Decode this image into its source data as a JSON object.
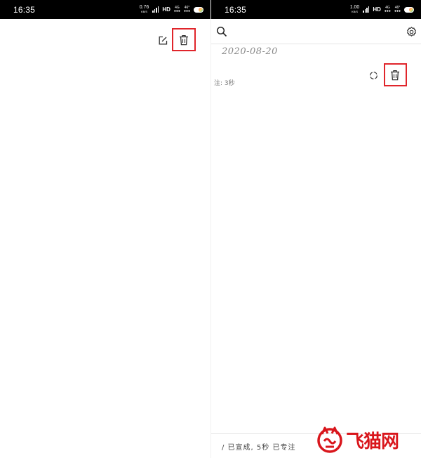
{
  "left": {
    "status": {
      "time": "16:35",
      "net_speed": "0.76",
      "net_unit": "KB/S",
      "hd": "HD",
      "net_type": "4G",
      "signal": "46°"
    }
  },
  "right": {
    "status": {
      "time": "16:35",
      "net_speed": "1.00",
      "net_unit": "KB/S",
      "hd": "HD",
      "net_type": "4G",
      "signal": "46°"
    },
    "date": "2020-08-20",
    "note": "注: 3秒",
    "bottom_status": "/ 已宣成, 5秒 已专注"
  },
  "watermark": {
    "text": "飞猫网"
  },
  "icons": {
    "edit": "edit-icon",
    "trash": "trash-icon",
    "search": "search-icon",
    "settings": "gear-icon",
    "refresh": "refresh-icon"
  },
  "colors": {
    "highlight": "#e0252b",
    "statusbar": "#000000",
    "watermark": "#d9161c"
  }
}
